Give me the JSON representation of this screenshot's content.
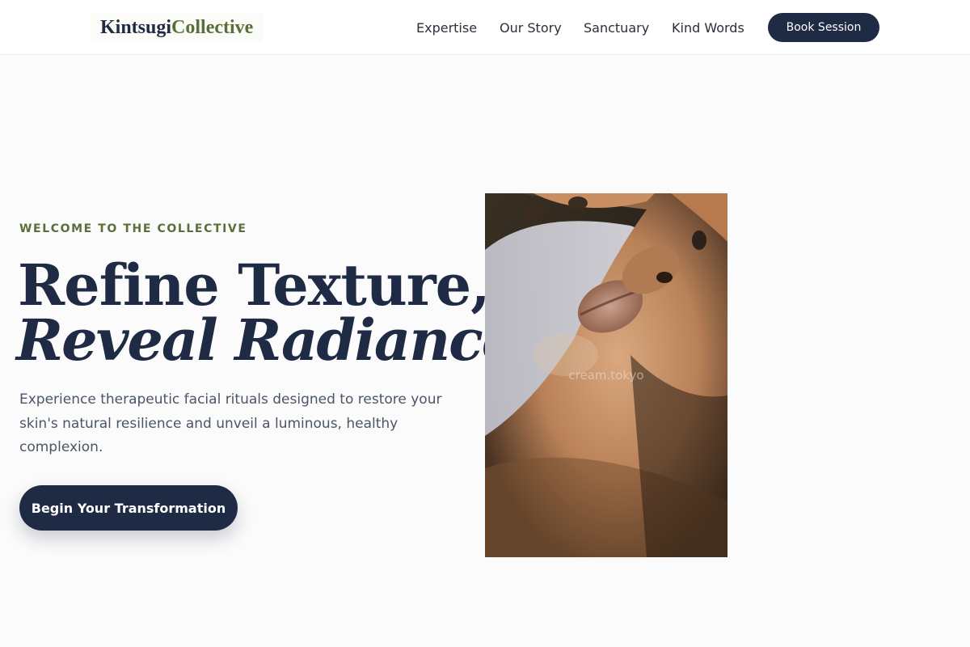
{
  "brand": {
    "part1": "Kintsugi",
    "part2": "Collective"
  },
  "nav": {
    "items": [
      "Expertise",
      "Our Story",
      "Sanctuary",
      "Kind Words"
    ],
    "cta_label": "Book Session"
  },
  "hero": {
    "eyebrow": "WELCOME TO THE COLLECTIVE",
    "headline_line1": "Refine Texture,",
    "headline_line2": "Reveal Radiance.",
    "body": "Experience therapeutic facial rituals designed to restore your skin's natural resilience and unveil a luminous, healthy complexion.",
    "cta_label": "Begin Your Transformation",
    "image_watermark": "cream.tokyo"
  },
  "colors": {
    "navy": "#1f2a44",
    "olive": "#5a6e3a",
    "background": "#fbfbfb",
    "body_text": "#4a5566"
  }
}
